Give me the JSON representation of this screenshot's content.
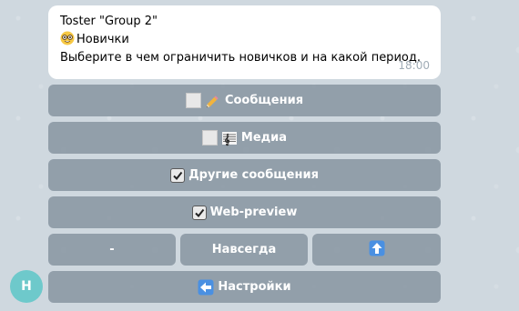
{
  "message": {
    "title": "Toster \"Group 2\"",
    "subtitle": "Новички",
    "text": "Выберите в чем ограничить новичков и на какой период.",
    "time": "18:00"
  },
  "keyboard": {
    "messages_label": "Сообщения",
    "media_label": "Медиа",
    "other_messages_label": "Другие сообщения",
    "web_preview_label": "Web-preview",
    "dash_label": "-",
    "forever_label": "Навсегда",
    "settings_label": "Настройки"
  },
  "avatar": {
    "initial": "Н"
  },
  "icons": {
    "messages": "unchecked-box-icon",
    "messages_pencil": "pencil-icon",
    "media": "unchecked-box-icon",
    "media_music": "musical-score-icon",
    "other_messages": "checked-box-icon",
    "web_preview": "checked-box-icon",
    "up": "up-arrow-icon",
    "settings": "left-arrow-icon",
    "subtitle": "nerd-face-icon"
  },
  "colors": {
    "button_bg": "#808e9b",
    "avatar_bg": "#6ec9cb",
    "time": "#a0acb6"
  }
}
